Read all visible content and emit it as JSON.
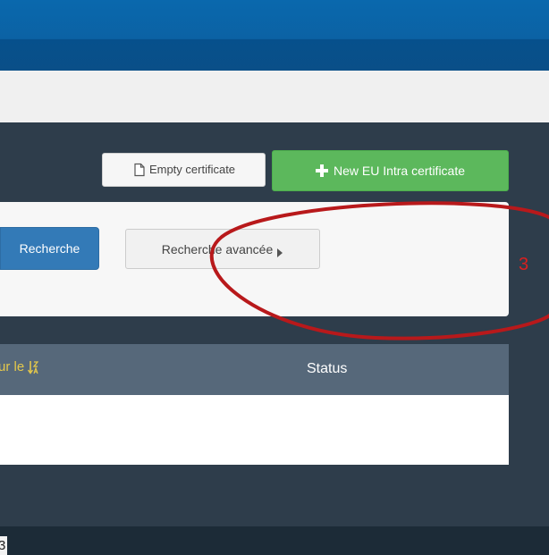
{
  "toolbar": {
    "empty_certificate_label": "Empty certificate",
    "new_certificate_label": "New EU Intra certificate"
  },
  "search": {
    "search_button_label": "Recherche",
    "advanced_button_label": "Recherche avancée"
  },
  "table": {
    "columns": [
      {
        "label": "ur le"
      },
      {
        "label": "Status"
      }
    ]
  },
  "annotation": {
    "number": "3"
  },
  "footer": {
    "text": "3"
  },
  "colors": {
    "header_blue": "#0b62a4",
    "success_green": "#5cb85c",
    "primary_blue": "#337ab7",
    "table_header": "#56687a",
    "sort_gold": "#e4c84b",
    "annotation_red": "#d9201f"
  },
  "icons": {
    "empty_certificate": "file-icon",
    "new_certificate": "plus-icon",
    "advanced_search": "caret-right-icon",
    "sort": "sort-alpha-desc-icon"
  }
}
